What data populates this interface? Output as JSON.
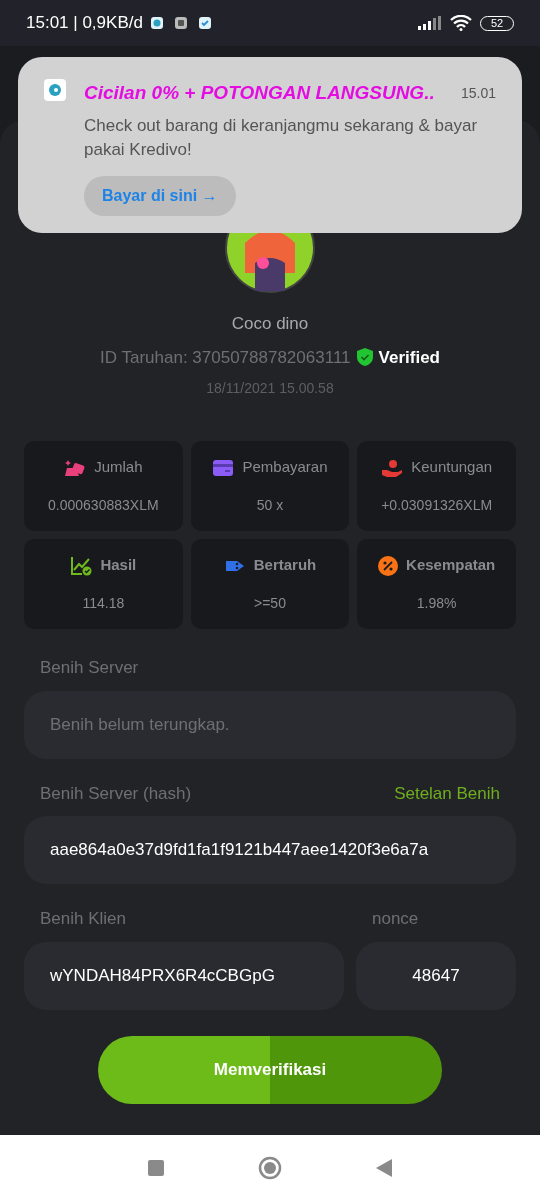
{
  "status_bar": {
    "time": "15:01 | 0,9KB/d",
    "battery": "52"
  },
  "notification": {
    "title": "Cicilan 0% + POTONGAN LANGSUNG..",
    "time": "15.01",
    "body": "Check out barang di keranjangmu sekarang & bayar pakai Kredivo!",
    "button": "Bayar di sini →"
  },
  "profile": {
    "name": "Coco dino",
    "bet_id": "ID Taruhan: 37050788782063111",
    "badge": "Verified",
    "date": "18/11/2021 15.00.58"
  },
  "stats": [
    {
      "label": "Jumlah",
      "value": "0.000630883XLM",
      "emphasized": false
    },
    {
      "label": "Pembayaran",
      "value": "50 x",
      "emphasized": false
    },
    {
      "label": "Keuntungan",
      "value": "+0.03091326XLM",
      "emphasized": false
    },
    {
      "label": "Hasil",
      "value": "114.18",
      "emphasized": true
    },
    {
      "label": "Bertaruh",
      "value": ">=50",
      "emphasized": true
    },
    {
      "label": "Kesempatan",
      "value": "1.98%",
      "emphasized": true
    }
  ],
  "server_seed": {
    "label": "Benih Server",
    "placeholder": "Benih belum terungkap."
  },
  "server_seed_hash": {
    "label": "Benih Server (hash)",
    "link": "Setelan Benih",
    "value": "aae864a0e37d9fd1fa1f9121b447aee1420f3e6a7a"
  },
  "client_seed": {
    "label": "Benih Klien",
    "value": "wYNDAH84PRX6R4cCBGpG"
  },
  "nonce": {
    "label": "nonce",
    "value": "48647"
  },
  "verify_button": "Memverifikasi"
}
